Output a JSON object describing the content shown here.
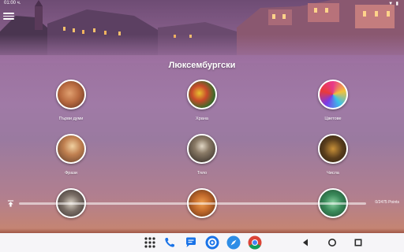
{
  "status_bar": {
    "time": "01:00 ч.",
    "icons": "▼ ▮"
  },
  "page": {
    "title": "Люксембургски"
  },
  "categories": [
    {
      "label": "Първи думи"
    },
    {
      "label": "Храна"
    },
    {
      "label": "Цветове"
    },
    {
      "label": "Фрази"
    },
    {
      "label": "Тяло"
    },
    {
      "label": "Числа"
    },
    {
      "label": ""
    },
    {
      "label": ""
    },
    {
      "label": ""
    }
  ],
  "progress": {
    "text": "0/2475 Points",
    "fraction": 0.0
  },
  "dock": {
    "apps": [
      "apps-grid-icon",
      "phone-icon",
      "messages-icon",
      "settings-icon",
      "safari-compass-icon",
      "chrome-icon"
    ]
  },
  "colors": {
    "accent_circle_border": "#ffffff",
    "nav_background": "#f6f5f8"
  }
}
